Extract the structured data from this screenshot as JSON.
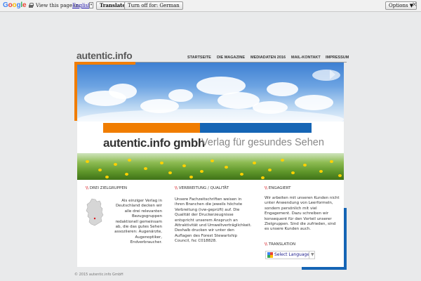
{
  "translate_bar": {
    "logo": "Google",
    "view_text": "View this page in:",
    "language": "English",
    "translate_button": "Translate",
    "turn_off_button": "Turn off for: German",
    "options_button": "Options ▼",
    "close_symbol": "×"
  },
  "site": {
    "title": "autentic.info",
    "nav": [
      "STARTSEITE",
      "DIE MAGAZINE",
      "MEDIADATEN 2016",
      "MAIL-KONTAKT",
      "IMPRESSUM"
    ],
    "company": "autentic.info gmbh",
    "tagline": "Verlag für gesundes Sehen"
  },
  "columns": [
    {
      "title": "DREI ZIELGRUPPEN",
      "text": "Als einziger Verlag in Deutschland decken wir alle drei relevanten Bezugsgruppen redaktionell gemeinsam ab, die das gutes Sehen assoziieren: Augenärzte, Augenoptiker, Endverbraucher."
    },
    {
      "title": "VERBREITUNG / QUALITÄT",
      "text": "Unsere Fachzeitschriften weisen in ihren Branchen die jeweils höchste Verbreitung (ivw-geprüft) auf. Die Qualität der Druckerzeugnisse entspricht unserem Anspruch an Attraktivität und Umweltverträglichkeit. Deshalb drucken wir unter den Auflagen des Forest Stewartship Council, fsc C018828."
    },
    {
      "title": "ENGAGIERT",
      "text": "Wir arbeiten mit unseren Kunden nicht unter Anwendung von Leerformeln, sondern persönlich mit viel Engagement. Dazu schreiben wir konsequent für den Vorteil unserer Zielgruppen. Sind die zufrieden, sind es unsere Kunden auch."
    },
    {
      "title": "TRANSLATION",
      "text": ""
    }
  ],
  "marker": "\\\\",
  "translate_widget": {
    "label": "Select Language",
    "arrow": "▼"
  },
  "copyright": "© 2015 autentic.info GmbH",
  "colors": {
    "orange": "#f07d00",
    "blue": "#1565b5",
    "marker_red": "#d7191f"
  }
}
